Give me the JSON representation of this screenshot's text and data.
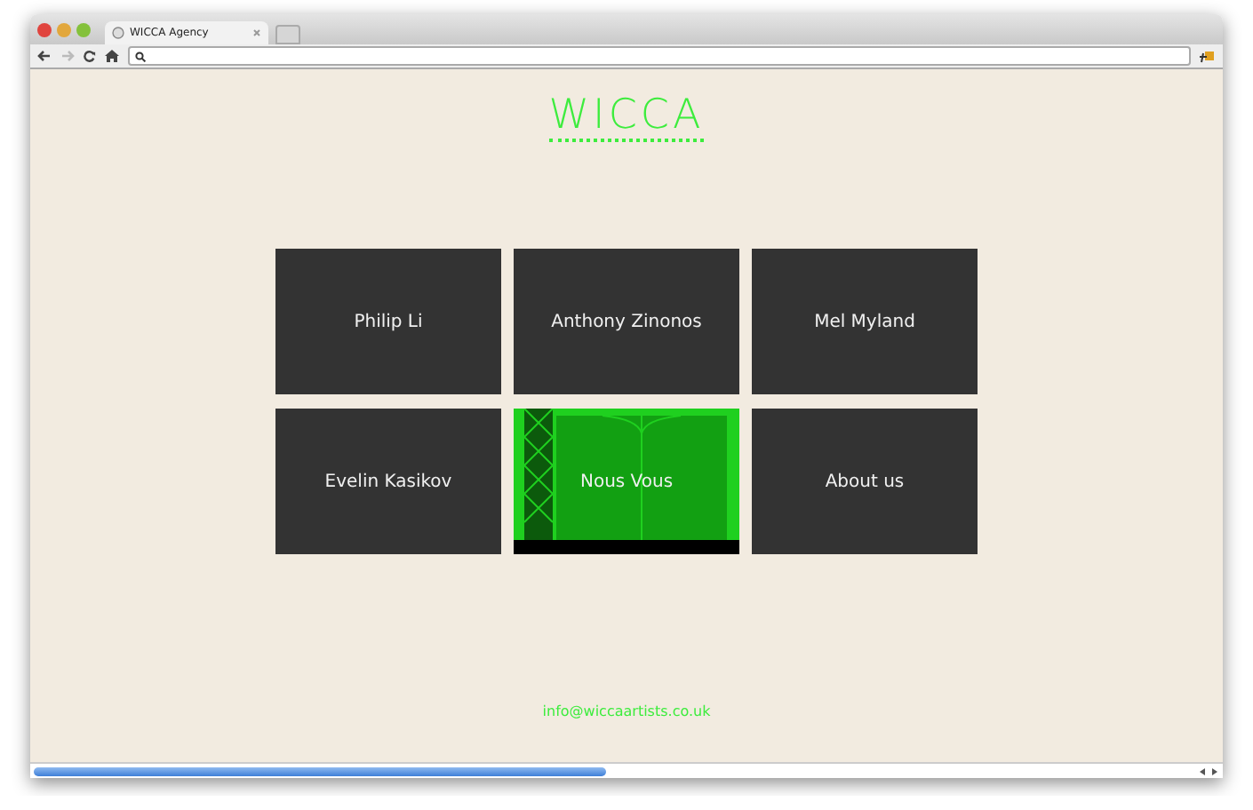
{
  "window": {
    "tab_title": "WICCA Agency"
  },
  "logo": "WICCA",
  "tiles": [
    {
      "label": "Philip Li",
      "kind": "plain"
    },
    {
      "label": "Anthony Zinonos",
      "kind": "plain"
    },
    {
      "label": "Mel Myland",
      "kind": "plain"
    },
    {
      "label": "Evelin Kasikov",
      "kind": "plain"
    },
    {
      "label": "Nous Vous",
      "kind": "image"
    },
    {
      "label": "About us",
      "kind": "plain"
    }
  ],
  "footer": {
    "email": "info@wiccaartists.co.uk"
  }
}
